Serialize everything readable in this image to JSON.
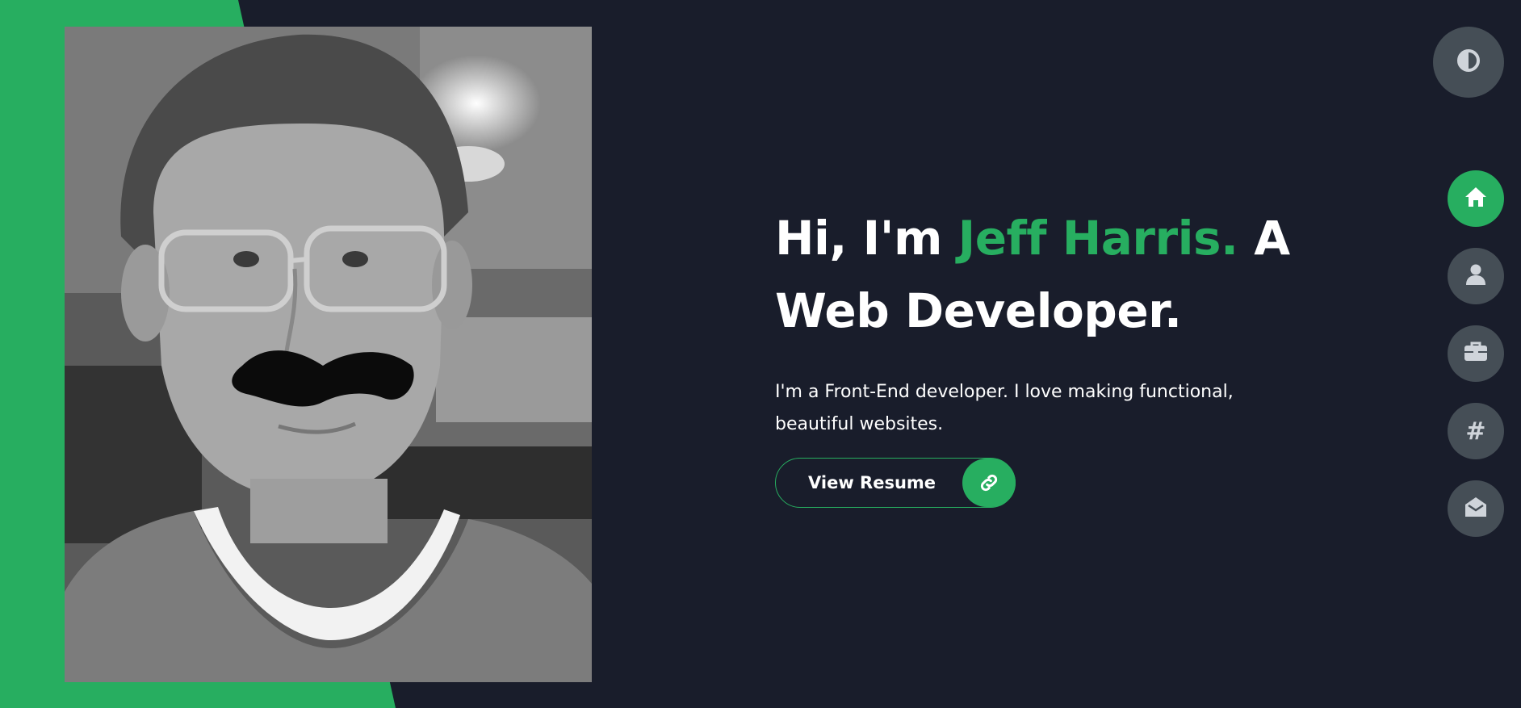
{
  "theme": {
    "accent": "#27ae60",
    "background": "#191d2b",
    "button_bg": "#454e56",
    "icon": "#cfd4da"
  },
  "hero": {
    "greeting": "Hi, I'm ",
    "name": "Jeff Harris.",
    "role_prefix": " A",
    "role": "Web Developer.",
    "bio": "I'm a Front-End developer. I love making functional, beautiful websites."
  },
  "resume_button": {
    "label": "View Resume",
    "icon": "link-icon"
  },
  "theme_toggle": {
    "icon": "contrast-icon"
  },
  "nav": {
    "items": [
      {
        "id": "home",
        "icon": "home-icon",
        "active": true
      },
      {
        "id": "about",
        "icon": "user-icon",
        "active": false
      },
      {
        "id": "portfolio",
        "icon": "briefcase-icon",
        "active": false
      },
      {
        "id": "blogs",
        "icon": "hashtag-icon",
        "glyph": "#",
        "active": false
      },
      {
        "id": "contact",
        "icon": "envelope-open-icon",
        "active": false
      }
    ]
  }
}
